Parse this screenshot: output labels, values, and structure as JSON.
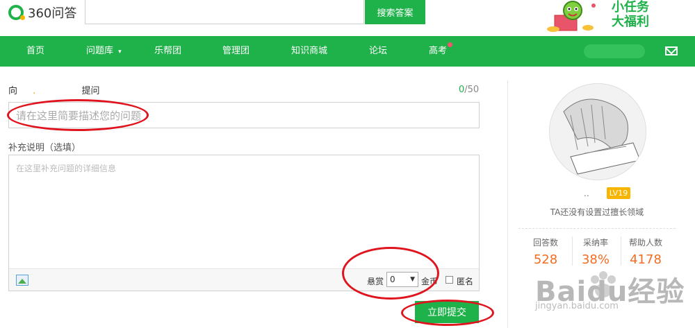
{
  "header": {
    "logo_text": "360问答",
    "search_button": "搜索答案",
    "promo_line1": "小任务",
    "promo_line2": "大福利"
  },
  "nav": {
    "items": [
      "首页",
      "问题库",
      "乐帮团",
      "管理团",
      "知识商城",
      "论坛",
      "高考"
    ]
  },
  "form": {
    "to_prefix": "向",
    "to_user": ".",
    "to_suffix": "提问",
    "counter_current": "0",
    "counter_max": "/50",
    "title_placeholder": "请在这里简要描述您的问题",
    "supplement_label": "补充说明（选填）",
    "supplement_placeholder": "在这里补充问题的详细信息",
    "reward_label": "悬赏",
    "reward_value": "0",
    "coin_label": "金币",
    "anonymous_label": "匿名",
    "submit_label": "立即提交"
  },
  "sidebar": {
    "username": "..",
    "level": "LV19",
    "expertise": "TA还没有设置过擅长领域",
    "stats": [
      {
        "label": "回答数",
        "value": "528"
      },
      {
        "label": "采纳率",
        "value": "38%"
      },
      {
        "label": "帮助人数",
        "value": "4178"
      }
    ]
  },
  "watermark": {
    "brand": "Baidu经验",
    "url": "jingyan.baidu.com"
  },
  "colors": {
    "brand_green": "#1fb24a",
    "stat_orange": "#f36c21",
    "badge_yellow": "#f8b500",
    "annotation_red": "#e0141e"
  }
}
